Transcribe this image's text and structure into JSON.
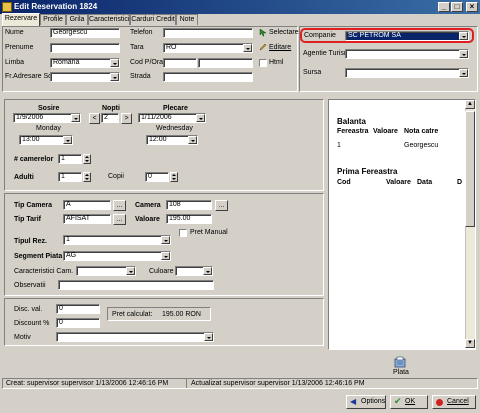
{
  "window": {
    "title": "Edit Reservation 1824"
  },
  "tabs": [
    "Rezervare",
    "Profile",
    "Grila",
    "Caracteristici",
    "Carduri Credit",
    "Note"
  ],
  "profile": {
    "nume_label": "Nume",
    "nume_value": "Georgescu",
    "prenume_label": "Prenume",
    "prenume_value": "",
    "limba_label": "Limba",
    "limba_value": "Romana",
    "fr_label": "Fr.Adresare Scr",
    "fr_value": "",
    "telefon_label": "Telefon",
    "telefon_value": "",
    "tara_label": "Tara",
    "tara_value": "RO",
    "cod_label": "Cod P/Oras",
    "cod_value": "",
    "oras_value": "",
    "strada_label": "Strada",
    "strada_value": "",
    "selectare_label": "Selectare",
    "editare_label": "Editare",
    "html_label": "Html"
  },
  "company": {
    "companie_label": "Companie",
    "companie_value": "SC PETROM SA",
    "agentie_label": "Agentie Turism",
    "agentie_value": "",
    "sursa_label": "Sursa",
    "sursa_value": ""
  },
  "stay": {
    "sosire_label": "Sosire",
    "sosire_value": "1/9/2006",
    "sosire_day": "Monday",
    "sosire_time": "13:00",
    "nopti_label": "Nopti",
    "nopti_value": "2",
    "prev": "<",
    "next": ">",
    "plecare_label": "Plecare",
    "plecare_value": "1/11/2006",
    "plecare_day": "Wednesday",
    "plecare_time": "12:00",
    "camere_label": "# camerelor",
    "camere_value": "1",
    "adulti_label": "Adulti",
    "adulti_value": "1",
    "copii_label": "Copii",
    "copii_value": "0"
  },
  "room": {
    "tip_camera_label": "Tip Camera",
    "tip_camera_value": "A",
    "camera_label": "Camera",
    "camera_value": "108",
    "tip_tarif_label": "Tip Tarif",
    "tip_tarif_value": "AFISAT",
    "valoare_label": "Valoare",
    "valoare_value": "195.00",
    "pret_manual_label": "Pret Manual",
    "tipul_rez_label": "Tipul Rez.",
    "tipul_rez_value": "1",
    "segment_label": "Segment Piata",
    "segment_value": "AG",
    "caract_label": "Caracteristici Cam.",
    "caract_value": "",
    "culoare_label": "Culoare",
    "culoare_value": "",
    "observatii_label": "Observatii",
    "observatii_value": "",
    "ellipsis": "..."
  },
  "discount": {
    "disc_val_label": "Disc. val.",
    "disc_val_value": "0",
    "disc_pct_label": "Discount %",
    "disc_pct_value": "0",
    "pret_calc_label": "Pret calculat:",
    "pret_calc_value": "195.00 RON",
    "motiv_label": "Motiv",
    "motiv_value": ""
  },
  "balance": {
    "title": "Balanta",
    "columns": [
      "Fereastra",
      "Valoare",
      "Nota catre"
    ],
    "rows": [
      {
        "fereastra": "1",
        "valoare": "",
        "nota": "Georgescu"
      }
    ],
    "prima_title": "Prima Fereastra",
    "prima_columns": [
      "Cod",
      "Valoare",
      "Data",
      "D"
    ],
    "plata_label": "Plata"
  },
  "status": {
    "created": "Creat: supervisor supervisor 1/13/2006 12:46:16 PM",
    "updated": "Actualizat supervisor supervisor 1/13/2006 12:46:16 PM"
  },
  "buttons": {
    "options": "Options",
    "ok": "OK",
    "cancel": "Cancel"
  },
  "colors": {
    "title_start": "#0a246a",
    "title_end": "#3a6ea5",
    "company_select": "#0a246a",
    "highlight_ring": "#e02020"
  }
}
